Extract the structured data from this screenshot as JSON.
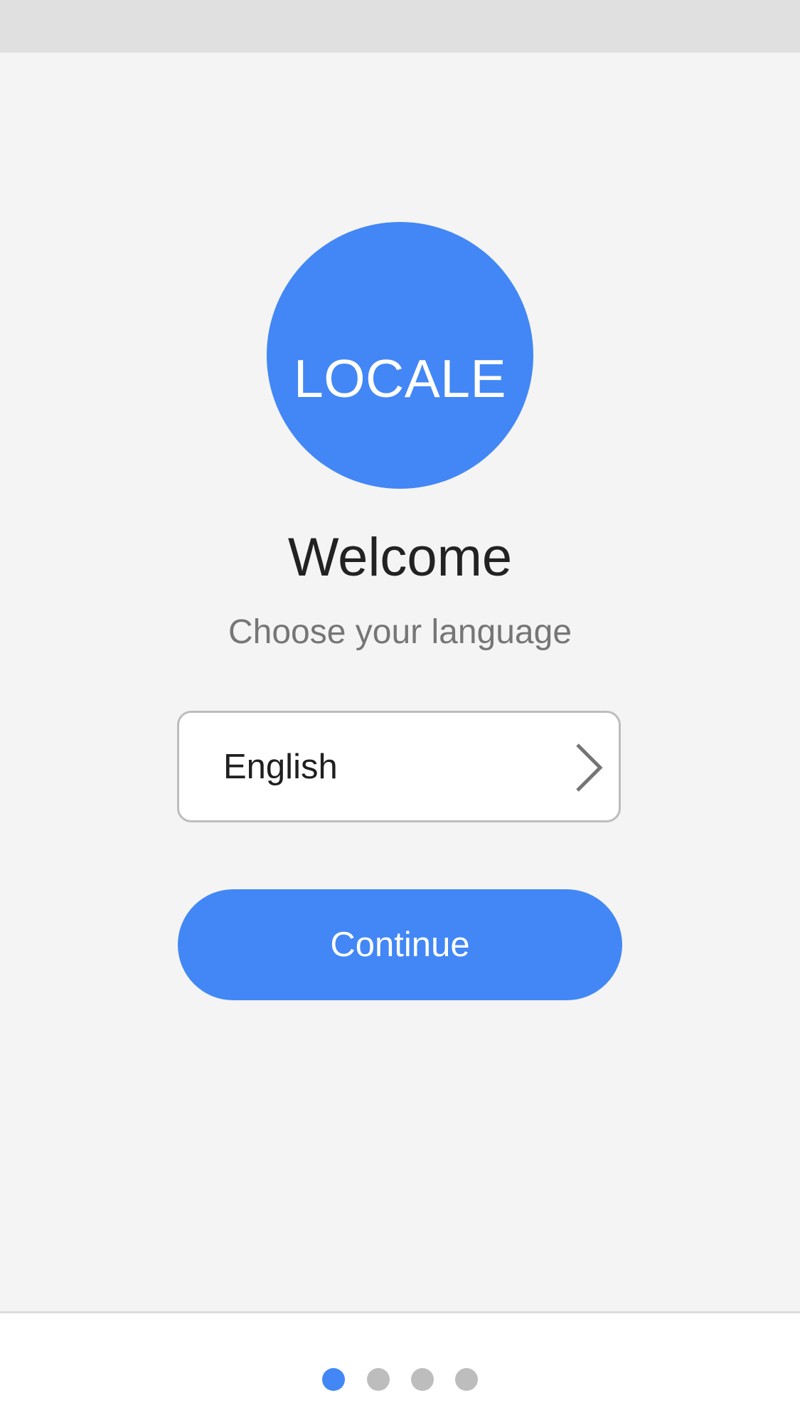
{
  "app": {
    "logo_text": "LOCALE"
  },
  "welcome": {
    "title": "Welcome",
    "subtitle": "Choose your language"
  },
  "language_select": {
    "value": "English",
    "icon": "chevron-right-icon"
  },
  "continue_button": {
    "label": "Continue"
  },
  "pagination": {
    "total": 4,
    "active_index": 0
  },
  "colors": {
    "accent": "#4287f5",
    "background": "#f4f4f4",
    "status_bar": "#e0e0e0",
    "inactive_dot": "#bdbdbd"
  }
}
